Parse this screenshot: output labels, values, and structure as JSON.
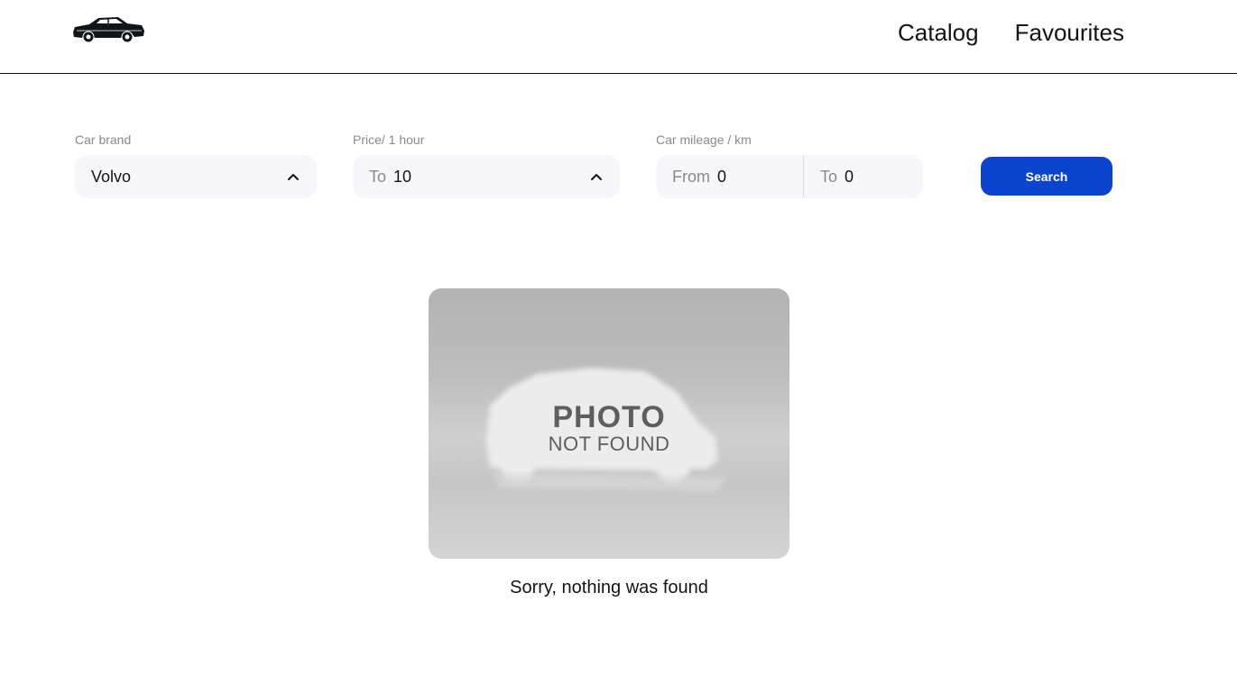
{
  "header": {
    "logo_icon": "classic-car-icon",
    "nav": {
      "catalog": "Catalog",
      "favourites": "Favourites"
    }
  },
  "filters": {
    "brand": {
      "label": "Car brand",
      "value": "Volvo",
      "icon": "chevron-up-icon"
    },
    "price": {
      "label": "Price/ 1 hour",
      "prefix": "To",
      "value": "10",
      "icon": "chevron-up-icon"
    },
    "mileage": {
      "label": "Car mileage / km",
      "from_prefix": "From",
      "from_value": "0",
      "to_prefix": "To",
      "to_value": "0"
    },
    "search_label": "Search"
  },
  "empty_state": {
    "image_line1": "PHOTO",
    "image_line2": "NOT FOUND",
    "message": "Sorry, nothing was found"
  },
  "colors": {
    "accent": "#0B44CD",
    "field_bg": "#F7F7FB",
    "label": "#8A8A89",
    "text": "#121417"
  }
}
